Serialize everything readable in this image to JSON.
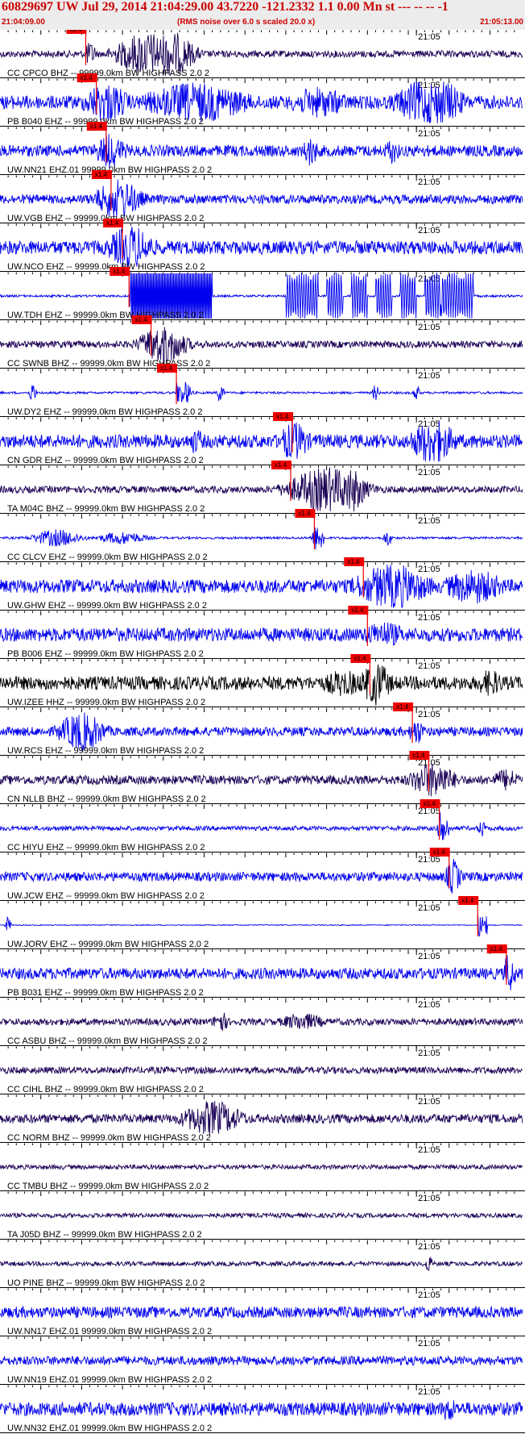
{
  "header": {
    "title": "60829697 UW Jul 29, 2014 21:04:29.00   43.7220 -121.2332  1.1 0.00 Mn st --- -- --  -1",
    "start_time": "21:04:09.00",
    "rms_note": "(RMS noise over 6.0 s scaled 20.0 x)",
    "end_time": "21:05:13.00"
  },
  "colors": {
    "blue": "#0000ee",
    "navy": "#1a0055",
    "black": "#000000",
    "pick": "#ee0000",
    "header_text": "#cc0000",
    "header_bg": "#ececec"
  },
  "chart_data": {
    "type": "seismogram",
    "time_axis": {
      "start": "21:04:09.00",
      "end": "21:05:13.00",
      "span_seconds": 64,
      "minute_mark_label": "21:05",
      "minute_mark_seconds": 51
    },
    "pick_label": "x1.4",
    "traces": [
      {
        "label": "CC CPCO BHZ -- 99999.0km BW  HIGHPASS  2.0  2",
        "color": "navy",
        "pick_s": 10.5,
        "noise": 0.15,
        "bursts": [
          [
            18,
            4,
            1.0
          ],
          [
            21,
            3,
            1.0
          ]
        ]
      },
      {
        "label": "PB B040 EHZ -- 99999.0km BW  HIGHPASS  2.0  2",
        "color": "blue",
        "pick_s": 11.8,
        "noise": 0.3,
        "bursts": [
          [
            13,
            3,
            0.9
          ],
          [
            24,
            7,
            0.9
          ],
          [
            39,
            4,
            0.7
          ],
          [
            52,
            4,
            1.0
          ],
          [
            54,
            3,
            1.0
          ]
        ]
      },
      {
        "label": "UW.NN21 EHZ.01 99999.0km BW  HIGHPASS  2.0  2",
        "color": "blue",
        "pick_s": 13.0,
        "noise": 0.25,
        "bursts": [
          [
            13.5,
            2,
            0.8
          ],
          [
            38,
            1,
            0.7
          ],
          [
            48,
            1,
            0.6
          ]
        ]
      },
      {
        "label": "UW.VGB EHZ -- 99999.0km BW  HIGHPASS  2.0  2",
        "color": "blue",
        "pick_s": 13.6,
        "noise": 0.2,
        "bursts": [
          [
            14.5,
            3,
            0.9
          ]
        ]
      },
      {
        "label": "UW.NCO EHZ -- 99999.0km BW  HIGHPASS  2.0  2",
        "color": "blue",
        "pick_s": 15.0,
        "noise": 0.3,
        "bursts": [
          [
            16,
            3,
            1.0
          ]
        ]
      },
      {
        "label": "UW.TDH EHZ -- 99999.0km BW  HIGHPASS  2.0  2",
        "color": "blue",
        "pick_s": 15.8,
        "noise": 0.05,
        "bursts": [],
        "saturated": [
          16,
          26
        ],
        "oscillations": [
          [
            37,
            2
          ],
          [
            41,
            1
          ],
          [
            44,
            1
          ],
          [
            47,
            1
          ],
          [
            50,
            1
          ],
          [
            53,
            1
          ],
          [
            56,
            2
          ]
        ]
      },
      {
        "label": "CC SWNB BHZ -- 99999.0km BW  HIGHPASS  2.0  2",
        "color": "navy",
        "pick_s": 18.5,
        "noise": 0.15,
        "bursts": [
          [
            20,
            3,
            0.9
          ]
        ]
      },
      {
        "label": "UW.DY2 EHZ -- 99999.0km BW  HIGHPASS  2.0  2",
        "color": "blue",
        "pick_s": 21.6,
        "noise": 0.05,
        "bursts": [
          [
            4,
            0.4,
            0.5
          ],
          [
            23,
            0.5,
            0.5
          ],
          [
            27,
            0.4,
            0.5
          ],
          [
            46,
            0.4,
            0.4
          ],
          [
            51,
            0.4,
            0.4
          ]
        ]
      },
      {
        "label": "CN GDR EHZ -- 99999.0km BW  HIGHPASS  2.0  2",
        "color": "blue",
        "pick_s": 35.8,
        "noise": 0.3,
        "bursts": [
          [
            24,
            1,
            0.6
          ],
          [
            36,
            2,
            0.9
          ],
          [
            53,
            3,
            1.0
          ]
        ]
      },
      {
        "label": "TA M04C BHZ -- 99999.0km BW  HIGHPASS  2.0  2",
        "color": "navy",
        "pick_s": 35.6,
        "noise": 0.15,
        "bursts": [
          [
            40,
            5,
            1.0
          ],
          [
            43,
            2,
            1.0
          ]
        ]
      },
      {
        "label": "CC CLCV EHZ -- 99999.0km BW  HIGHPASS  2.0  2",
        "color": "blue",
        "pick_s": 38.5,
        "noise": 0.05,
        "bursts": [
          [
            7,
            3,
            0.4
          ],
          [
            15,
            3,
            0.3
          ],
          [
            38.8,
            0.6,
            0.6
          ],
          [
            47.5,
            0.5,
            0.4
          ]
        ]
      },
      {
        "label": "UW.GHW EHZ -- 99999.0km BW  HIGHPASS  2.0  2",
        "color": "blue",
        "pick_s": 44.5,
        "noise": 0.3,
        "bursts": [
          [
            48,
            5,
            1.0
          ],
          [
            58,
            4,
            0.8
          ]
        ]
      },
      {
        "label": "PB B006 EHZ -- 99999.0km BW  HIGHPASS  2.0  2",
        "color": "blue",
        "pick_s": 45.0,
        "noise": 0.3,
        "bursts": [
          [
            47,
            3,
            0.6
          ]
        ]
      },
      {
        "label": "UW.IZEE HHZ -- 99999.0km BW  HIGHPASS  2.0  2",
        "color": "black",
        "pick_s": 45.3,
        "noise": 0.3,
        "bursts": [
          [
            42,
            3,
            0.6
          ],
          [
            46,
            2,
            1.0
          ],
          [
            60,
            2,
            0.6
          ]
        ]
      },
      {
        "label": "UW.RCS EHZ -- 99999.0km BW  HIGHPASS  2.0  2",
        "color": "blue",
        "pick_s": 50.5,
        "noise": 0.2,
        "bursts": [
          [
            10,
            3,
            0.9
          ],
          [
            51,
            1,
            0.6
          ]
        ]
      },
      {
        "label": "CN NLLB BHZ -- 99999.0km BW  HIGHPASS  2.0  2",
        "color": "navy",
        "pick_s": 52.5,
        "noise": 0.2,
        "bursts": [
          [
            53,
            3,
            0.8
          ],
          [
            62,
            2,
            0.5
          ]
        ]
      },
      {
        "label": "CC HIYU EHZ -- 99999.0km BW  HIGHPASS  2.0  2",
        "color": "blue",
        "pick_s": 53.8,
        "noise": 0.1,
        "bursts": [
          [
            54.2,
            0.5,
            1.0
          ],
          [
            59,
            0.5,
            0.4
          ]
        ]
      },
      {
        "label": "UW.JCW EHZ -- 99999.0km BW  HIGHPASS  2.0  2",
        "color": "blue",
        "pick_s": 55.0,
        "noise": 0.2,
        "bursts": [
          [
            55.5,
            1,
            0.8
          ]
        ]
      },
      {
        "label": "UW.JORV EHZ -- 99999.0km BW  HIGHPASS  2.0  2",
        "color": "blue",
        "pick_s": 58.5,
        "noise": 0.02,
        "bursts": [
          [
            1,
            0.3,
            0.4
          ]
        ]
      },
      {
        "label": "PB B031 EHZ -- 99999.0km BW  HIGHPASS  2.0  2",
        "color": "blue",
        "pick_s": 62.0,
        "noise": 0.25,
        "bursts": [
          [
            62.3,
            0.6,
            1.0
          ]
        ]
      },
      {
        "label": "CC ASBU BHZ -- 99999.0km BW  HIGHPASS  2.0  2",
        "color": "navy",
        "pick_s": null,
        "noise": 0.15,
        "bursts": [
          [
            27,
            1,
            0.5
          ],
          [
            37,
            3,
            0.4
          ]
        ]
      },
      {
        "label": "CC CIHL BHZ -- 99999.0km BW  HIGHPASS  2.0  2",
        "color": "navy",
        "pick_s": null,
        "noise": 0.15,
        "bursts": []
      },
      {
        "label": "CC NORM BHZ -- 99999.0km BW  HIGHPASS  2.0  2",
        "color": "navy",
        "pick_s": null,
        "noise": 0.2,
        "bursts": [
          [
            26,
            4,
            0.8
          ]
        ]
      },
      {
        "label": "CC TMBU BHZ -- 99999.0km BW  HIGHPASS  2.0  2",
        "color": "navy",
        "pick_s": null,
        "noise": 0.1,
        "bursts": []
      },
      {
        "label": "TA J05D BHZ -- 99999.0km BW  HIGHPASS  2.0  2",
        "color": "navy",
        "pick_s": null,
        "noise": 0.1,
        "bursts": []
      },
      {
        "label": "UO PINE BHZ -- 99999.0km BW  HIGHPASS  2.0  2",
        "color": "navy",
        "pick_s": null,
        "noise": 0.1,
        "bursts": [
          [
            52.5,
            0.5,
            0.4
          ]
        ]
      },
      {
        "label": "UW.NN17 EHZ.01 99999.0km BW  HIGHPASS  2.0  2",
        "color": "blue",
        "pick_s": null,
        "noise": 0.25,
        "bursts": []
      },
      {
        "label": "UW.NN19 EHZ.01 99999.0km BW  HIGHPASS  2.0  2",
        "color": "blue",
        "pick_s": null,
        "noise": 0.2,
        "bursts": []
      },
      {
        "label": "UW.NN32 EHZ.01 99999.0km BW  HIGHPASS  2.0  2",
        "color": "blue",
        "pick_s": null,
        "noise": 0.3,
        "bursts": [
          [
            55,
            1,
            0.6
          ]
        ]
      }
    ]
  }
}
